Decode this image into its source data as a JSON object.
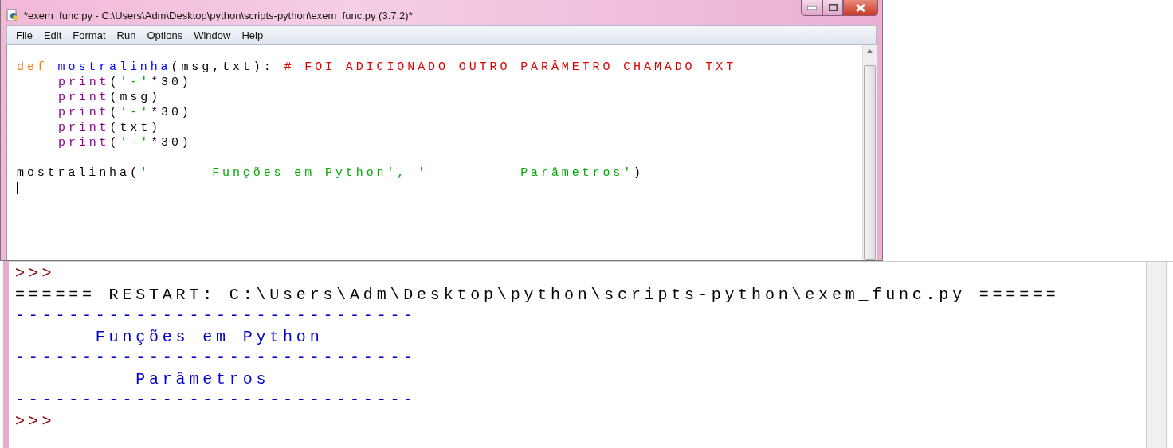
{
  "window": {
    "title": "*exem_func.py - C:\\Users\\Adm\\Desktop\\python\\scripts-python\\exem_func.py (3.7.2)*"
  },
  "menu": [
    "File",
    "Edit",
    "Format",
    "Run",
    "Options",
    "Window",
    "Help"
  ],
  "editor": {
    "lines": [
      {
        "indent": false,
        "gap_before": true,
        "tokens": [
          {
            "kind": "keyword",
            "text": "def "
          },
          {
            "kind": "definition",
            "text": "mostralinha"
          },
          {
            "kind": "plain",
            "text": "(msg,txt): "
          },
          {
            "kind": "comment",
            "text": "# FOI ADICIONADO OUTRO PARÂMETRO CHAMADO TXT"
          }
        ]
      },
      {
        "indent": true,
        "gap_before": false,
        "tokens": [
          {
            "kind": "builtin",
            "text": "print"
          },
          {
            "kind": "plain",
            "text": "("
          },
          {
            "kind": "string",
            "text": "'-'"
          },
          {
            "kind": "plain",
            "text": "*30)"
          }
        ]
      },
      {
        "indent": true,
        "gap_before": false,
        "tokens": [
          {
            "kind": "builtin",
            "text": "print"
          },
          {
            "kind": "plain",
            "text": "(msg)"
          }
        ]
      },
      {
        "indent": true,
        "gap_before": false,
        "tokens": [
          {
            "kind": "builtin",
            "text": "print"
          },
          {
            "kind": "plain",
            "text": "("
          },
          {
            "kind": "string",
            "text": "'-'"
          },
          {
            "kind": "plain",
            "text": "*30)"
          }
        ]
      },
      {
        "indent": true,
        "gap_before": false,
        "tokens": [
          {
            "kind": "builtin",
            "text": "print"
          },
          {
            "kind": "plain",
            "text": "(txt)"
          }
        ]
      },
      {
        "indent": true,
        "gap_before": false,
        "tokens": [
          {
            "kind": "builtin",
            "text": "print"
          },
          {
            "kind": "plain",
            "text": "("
          },
          {
            "kind": "string",
            "text": "'-'"
          },
          {
            "kind": "plain",
            "text": "*30)"
          }
        ]
      },
      {
        "indent": false,
        "gap_before": true,
        "tokens": [
          {
            "kind": "plain",
            "text": "mostralinha("
          },
          {
            "kind": "string",
            "text": "'      Funções em Python', '         Parâmetros'"
          },
          {
            "kind": "plain",
            "text": ")"
          }
        ]
      }
    ]
  },
  "shell": {
    "lines": [
      {
        "kind": "prompt",
        "text": ">>>"
      },
      {
        "kind": "restart",
        "text": "====== RESTART: C:\\Users\\Adm\\Desktop\\python\\scripts-python\\exem_func.py ======"
      },
      {
        "kind": "output",
        "text": "------------------------------"
      },
      {
        "kind": "output",
        "text": "      Funções em Python"
      },
      {
        "kind": "output",
        "text": "------------------------------"
      },
      {
        "kind": "output",
        "text": "         Parâmetros"
      },
      {
        "kind": "output",
        "text": "------------------------------"
      },
      {
        "kind": "prompt",
        "text": ">>>"
      }
    ]
  }
}
